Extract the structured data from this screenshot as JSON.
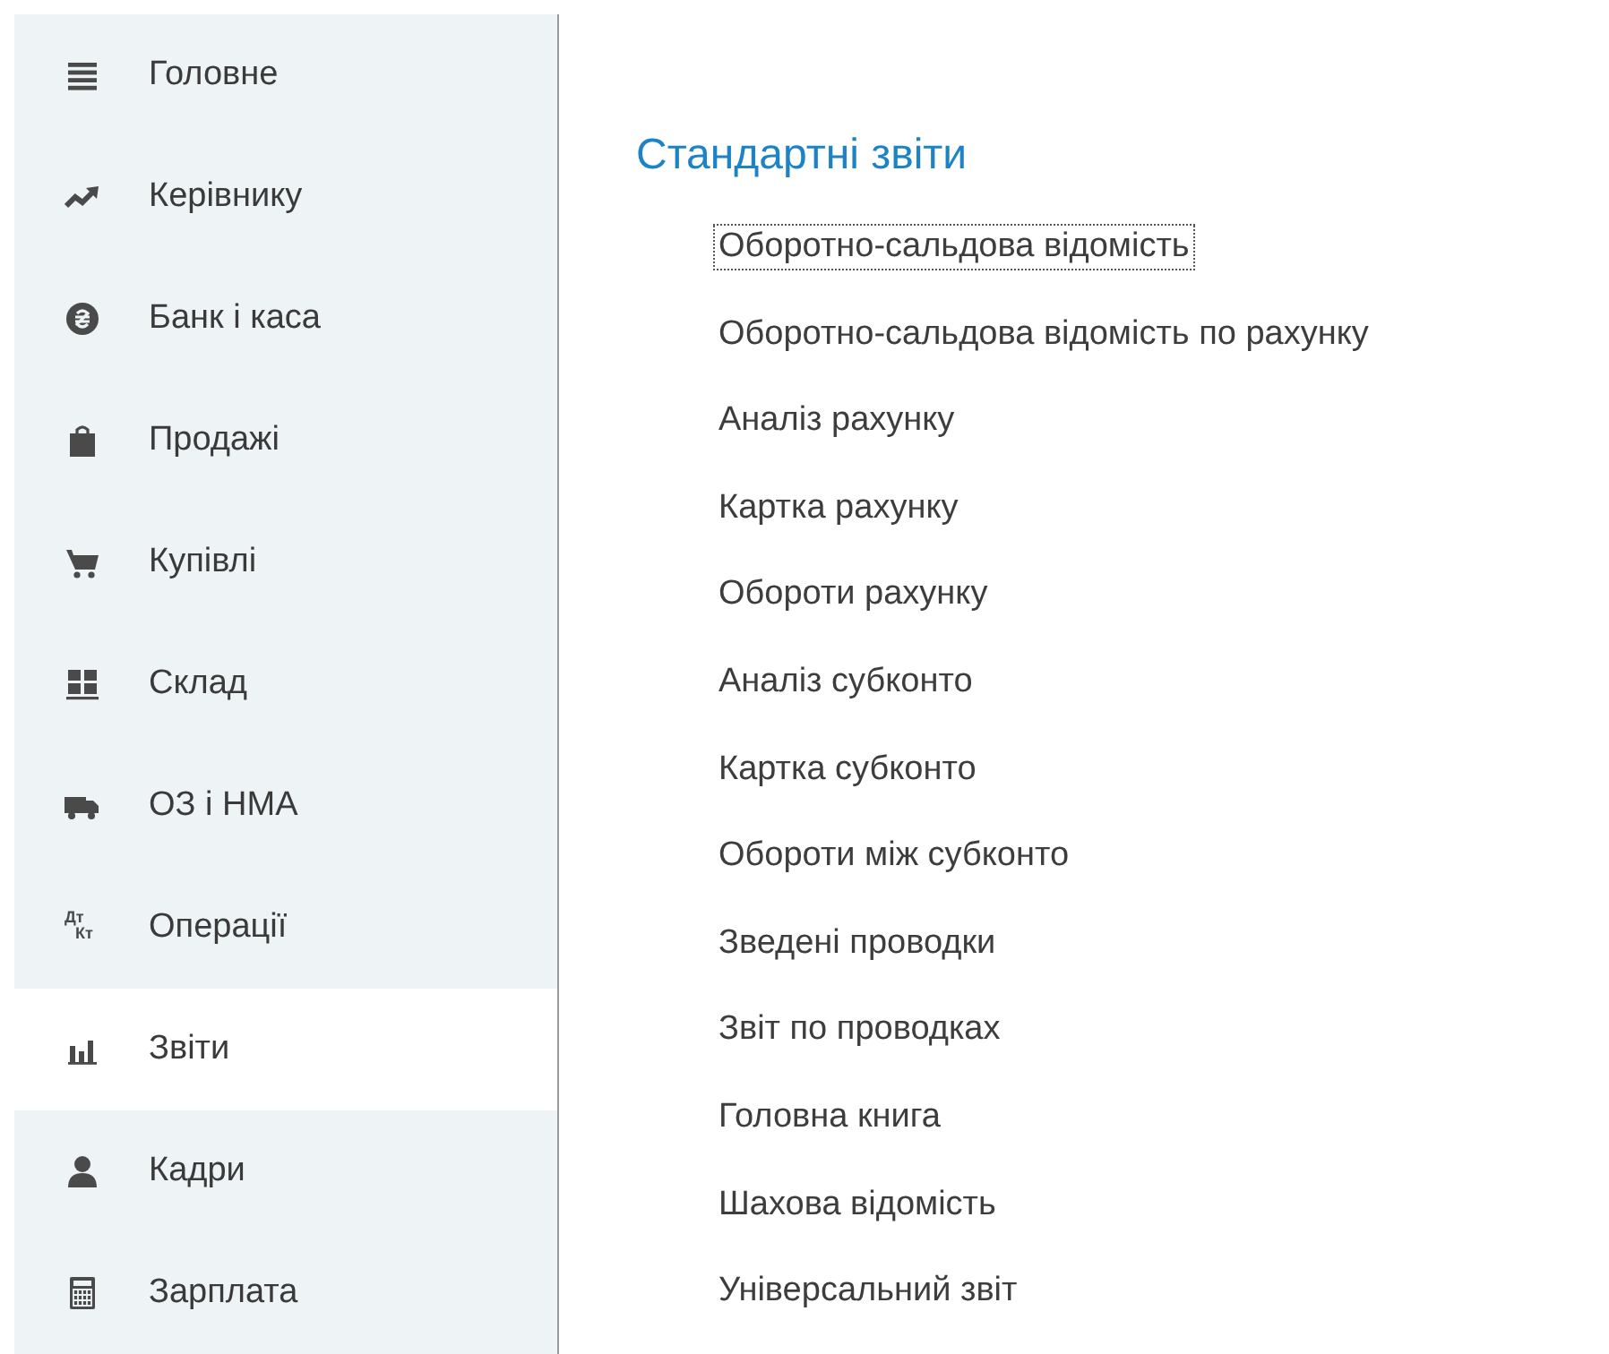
{
  "sidebar": {
    "items": [
      {
        "label": "Головне",
        "selected": false
      },
      {
        "label": "Керівнику",
        "selected": false
      },
      {
        "label": "Банк і каса",
        "selected": false
      },
      {
        "label": "Продажі",
        "selected": false
      },
      {
        "label": "Купівлі",
        "selected": false
      },
      {
        "label": "Склад",
        "selected": false
      },
      {
        "label": "ОЗ і НМА",
        "selected": false
      },
      {
        "label": "Операції",
        "selected": false,
        "icon_top": "Дт",
        "icon_bottom": "Кт"
      },
      {
        "label": "Звіти",
        "selected": true
      },
      {
        "label": "Кадри",
        "selected": false
      },
      {
        "label": "Зарплата",
        "selected": false
      }
    ]
  },
  "section": {
    "title": "Стандартні звіти",
    "links": [
      {
        "label": "Оборотно-сальдова відомість",
        "focused": true
      },
      {
        "label": "Оборотно-сальдова відомість по рахунку",
        "focused": false
      },
      {
        "label": "Аналіз рахунку",
        "focused": false
      },
      {
        "label": "Картка рахунку",
        "focused": false
      },
      {
        "label": "Обороти рахунку",
        "focused": false
      },
      {
        "label": "Аналіз субконто",
        "focused": false
      },
      {
        "label": "Картка субконто",
        "focused": false
      },
      {
        "label": "Обороти між субконто",
        "focused": false
      },
      {
        "label": "Зведені проводки",
        "focused": false
      },
      {
        "label": "Звіт по проводках",
        "focused": false
      },
      {
        "label": "Головна книга",
        "focused": false
      },
      {
        "label": "Шахова відомість",
        "focused": false
      },
      {
        "label": "Універсальний звіт",
        "focused": false
      }
    ]
  }
}
